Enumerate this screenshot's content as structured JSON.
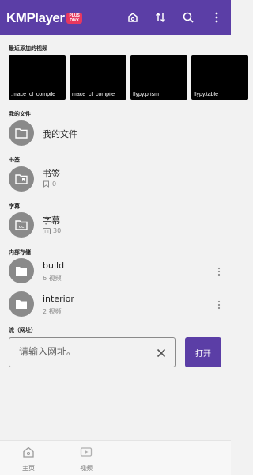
{
  "app": {
    "logo_text": "KMPlayer",
    "badge_line1": "PLUS",
    "badge_line2": "DIVX"
  },
  "sections": {
    "recent": "最近添加的视频",
    "my_files": "我的文件",
    "bookmarks": "书签",
    "subtitles": "字幕",
    "internal": "内部存储",
    "stream": "流（网址）"
  },
  "recent_videos": [
    {
      "caption": ".mace_cl_compile"
    },
    {
      "caption": "mace_cl_compile"
    },
    {
      "caption": "flypy.prism"
    },
    {
      "caption": "flypy.table"
    }
  ],
  "my_files": {
    "title": "我的文件"
  },
  "bookmarks": {
    "title": "书签",
    "count": "0"
  },
  "subtitles": {
    "title": "字幕",
    "count": "30"
  },
  "folders": [
    {
      "name": "build",
      "count": "6 视频"
    },
    {
      "name": "interior",
      "count": "2 视频"
    }
  ],
  "stream": {
    "placeholder": "请输入网址。",
    "open_label": "打开"
  },
  "bottom_nav": [
    {
      "label": "主页"
    },
    {
      "label": "视频"
    }
  ],
  "colors": {
    "primary": "#5b3ea6",
    "badge": "#e8375f",
    "icon_gray": "#8a8a8a"
  },
  "icons": [
    "cast-icon",
    "sort-icon",
    "search-icon",
    "more-vertical-icon",
    "folder-icon",
    "bookmark-icon",
    "subtitle-icon",
    "close-icon",
    "home-icon",
    "video-icon"
  ]
}
